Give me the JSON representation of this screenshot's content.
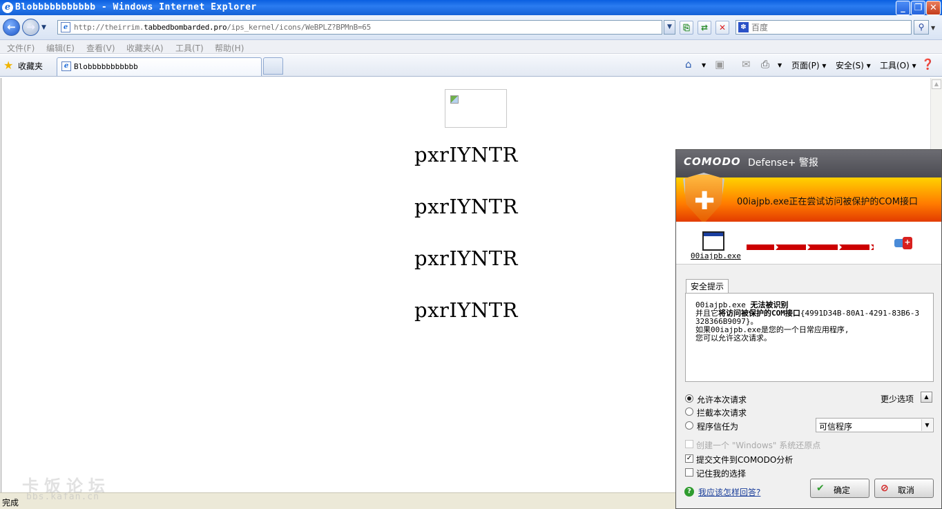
{
  "window": {
    "title": "Blobbbbbbbbbbb - Windows Internet Explorer",
    "icons": [
      "ie-icon",
      "minimize-icon",
      "restore-icon",
      "close-icon"
    ]
  },
  "navbar": {
    "url_prefix": "http://theirrim.",
    "url_domain": "tabbedbombarded.pro",
    "url_path": "/ips_kernel/icons/WeBPLZ?BPMnB=65",
    "search_placeholder": "百度"
  },
  "menu": {
    "items": [
      "文件(F)",
      "编辑(E)",
      "查看(V)",
      "收藏夹(A)",
      "工具(T)",
      "帮助(H)"
    ]
  },
  "favbar": {
    "favorites_label": "收藏夹",
    "tab_label": "Blobbbbbbbbbbb",
    "commands": [
      "页面(P)",
      "安全(S)",
      "工具(O)"
    ]
  },
  "page": {
    "lines": [
      "pxrIYNTR",
      "pxrIYNTR",
      "pxrIYNTR",
      "pxrIYNTR"
    ]
  },
  "status": {
    "text": "完成"
  },
  "watermark": {
    "chinese": "卡饭论坛",
    "url": "bbs.kafan.cn"
  },
  "comodo": {
    "brand": "COMODO",
    "title": "Defense+ 警报",
    "alert": "00iajpb.exe正在尝试访问被保护的COM接口",
    "exe_name": "00iajpb.exe",
    "tab": "安全提示",
    "info": {
      "line1_exe": "00iajpb.exe ",
      "line1_bold": "无法被识别",
      "line2_prefix": "并且它",
      "line2_bold": "将访问被保护的COM接口",
      "line2_rest": "{4991D34B-80A1-4291-83B6-3328366B9097}。",
      "line3": "如果00iajpb.exe是您的一个日常应用程序,",
      "line4": "您可以允许这次请求。"
    },
    "fewer_options": "更少选项",
    "options": {
      "allow": "允许本次请求",
      "block": "拦截本次请求",
      "treat_as": "程序信任为",
      "treat_as_value": "可信程序"
    },
    "checkboxes": {
      "restore_point": "创建一个 \"Windows\" 系统还原点",
      "submit": "提交文件到COMODO分析",
      "remember": "记住我的选择"
    },
    "help_link": "我应该怎样回答?",
    "ok": "确定",
    "cancel": "取消"
  }
}
